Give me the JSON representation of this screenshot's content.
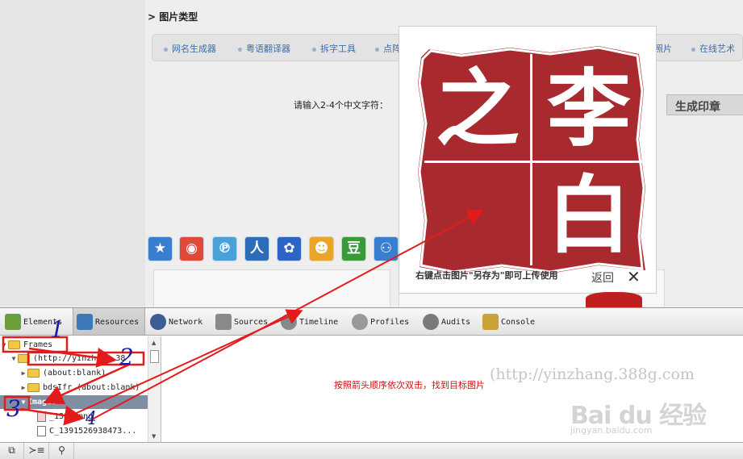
{
  "page": {
    "section_title": "> 图片类型",
    "nav_items": [
      "网名生成器",
      "粤语翻译器",
      "拆字工具",
      "点阵",
      "照片",
      "在线艺术"
    ],
    "input_label": "请输入2-4个中文字符：",
    "generate_button": "生成印章",
    "social_icons": [
      "qzone-icon",
      "weibo-icon",
      "tencent-weibo-icon",
      "renren-icon",
      "baidu-icon",
      "kaixin-icon",
      "douban-icon",
      "friends-icon"
    ]
  },
  "modal": {
    "seal_chars": [
      "李",
      "之",
      "白",
      ""
    ],
    "hint": "右键点击图片\"另存为\"即可上传使用",
    "back_label": "返回",
    "close_glyph": "✕"
  },
  "devtools": {
    "tabs": [
      {
        "label": "Elements",
        "icon": "elements-icon",
        "color": "#6a9e3a"
      },
      {
        "label": "Resources",
        "icon": "resources-icon",
        "color": "#3f78b8"
      },
      {
        "label": "Network",
        "icon": "network-icon",
        "color": "#3d5e94"
      },
      {
        "label": "Sources",
        "icon": "sources-icon",
        "color": "#8a8a8a"
      },
      {
        "label": "Timeline",
        "icon": "timeline-icon",
        "color": "#888888"
      },
      {
        "label": "Profiles",
        "icon": "profiles-icon",
        "color": "#999999"
      },
      {
        "label": "Audits",
        "icon": "audits-icon",
        "color": "#7a7a7a"
      },
      {
        "label": "Console",
        "icon": "console-icon",
        "color": "#c9a23a"
      }
    ],
    "tree": [
      {
        "label": "Frames",
        "kind": "folder",
        "expanded": "▼",
        "selected": false
      },
      {
        "label": "(http://yinzhang.38",
        "kind": "folder",
        "expanded": "▼",
        "selected": false
      },
      {
        "label": "(about:blank)",
        "kind": "folder",
        "expanded": "▶",
        "selected": false
      },
      {
        "label": "bdsIfr (about:blank)",
        "kind": "folder",
        "expanded": "▶",
        "selected": false
      },
      {
        "label": "Images",
        "kind": "group",
        "expanded": "▼",
        "selected": true
      },
      {
        "label": "_1384.png",
        "kind": "file",
        "expanded": "",
        "selected": false
      },
      {
        "label": "C_1391526938473...",
        "kind": "file",
        "expanded": "",
        "selected": false
      }
    ],
    "main_note": "按照箭头顺序依次双击，找到目标图片",
    "status_buttons": [
      "⧉",
      "≻≡",
      "⚲"
    ]
  },
  "watermark": {
    "url": "(http://yinzhang.388g.com",
    "logo": "Bai du 经验",
    "site": "jingyan.baidu.com"
  },
  "annotations": {
    "numbers": [
      "1",
      "2",
      "3",
      "4"
    ],
    "color": "#e41b1b",
    "ink_color": "#1a1aa8"
  }
}
